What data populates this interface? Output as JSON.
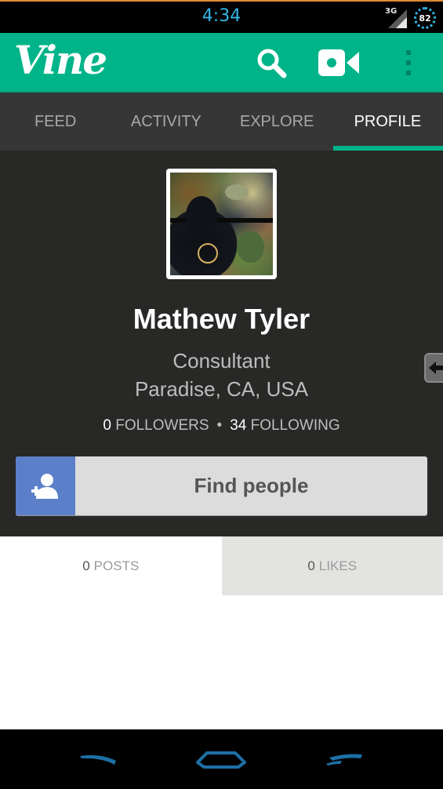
{
  "status_bar": {
    "time": "4:34",
    "network_type": "3G",
    "battery_level": "82"
  },
  "app_bar": {
    "logo_text": "Vine",
    "accent_color": "#00b489",
    "icons": [
      "search-icon",
      "video-camera-icon",
      "overflow-menu-icon"
    ]
  },
  "tabs": [
    {
      "label": "FEED"
    },
    {
      "label": "ACTIVITY"
    },
    {
      "label": "EXPLORE"
    },
    {
      "label": "PROFILE",
      "active": true
    }
  ],
  "profile": {
    "name": "Mathew Tyler",
    "description": "Consultant",
    "location": "Paradise, CA, USA",
    "followers_count": "0",
    "followers_label": "FOLLOWERS",
    "following_count": "34",
    "following_label": "FOLLOWING",
    "find_people_label": "Find people"
  },
  "sub_tabs": {
    "posts_count": "0",
    "posts_label": "POSTS",
    "likes_count": "0",
    "likes_label": "LIKES"
  },
  "nav_bar": {
    "buttons": [
      "back-icon",
      "home-icon",
      "recent-apps-icon"
    ]
  }
}
